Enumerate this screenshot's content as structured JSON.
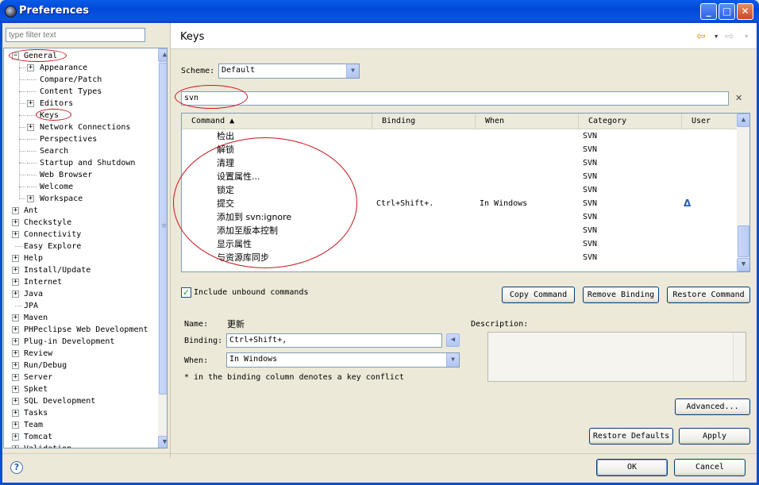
{
  "window": {
    "title": "Preferences",
    "minimize": "_",
    "maximize": "□",
    "close": "✕"
  },
  "filter": {
    "placeholder": "type filter text"
  },
  "tree": {
    "expand_plus": "+",
    "expand_minus": "−",
    "general": "General",
    "general_children": [
      {
        "label": "Appearance",
        "expandable": true
      },
      {
        "label": "Compare/Patch",
        "expandable": false
      },
      {
        "label": "Content Types",
        "expandable": false
      },
      {
        "label": "Editors",
        "expandable": true
      },
      {
        "label": "Keys",
        "expandable": false
      },
      {
        "label": "Network Connections",
        "expandable": true
      },
      {
        "label": "Perspectives",
        "expandable": false
      },
      {
        "label": "Search",
        "expandable": false
      },
      {
        "label": "Startup and Shutdown",
        "expandable": false
      },
      {
        "label": "Web Browser",
        "expandable": false
      },
      {
        "label": "Welcome",
        "expandable": false
      },
      {
        "label": "Workspace",
        "expandable": true
      }
    ],
    "top_items": [
      {
        "label": "Ant",
        "expandable": true
      },
      {
        "label": "Checkstyle",
        "expandable": true
      },
      {
        "label": "Connectivity",
        "expandable": true
      },
      {
        "label": "Easy Explore",
        "expandable": false
      },
      {
        "label": "Help",
        "expandable": true
      },
      {
        "label": "Install/Update",
        "expandable": true
      },
      {
        "label": "Internet",
        "expandable": true
      },
      {
        "label": "Java",
        "expandable": true
      },
      {
        "label": "JPA",
        "expandable": false
      },
      {
        "label": "Maven",
        "expandable": true
      },
      {
        "label": "PHPeclipse Web Development",
        "expandable": true
      },
      {
        "label": "Plug-in Development",
        "expandable": true
      },
      {
        "label": "Review",
        "expandable": true
      },
      {
        "label": "Run/Debug",
        "expandable": true
      },
      {
        "label": "Server",
        "expandable": true
      },
      {
        "label": "Spket",
        "expandable": true
      },
      {
        "label": "SQL Development",
        "expandable": true
      },
      {
        "label": "Tasks",
        "expandable": true
      },
      {
        "label": "Team",
        "expandable": true
      },
      {
        "label": "Tomcat",
        "expandable": true
      },
      {
        "label": "Validation",
        "expandable": true
      }
    ],
    "scroll_up": "▲",
    "scroll_down": "▼",
    "scroll_grip": "≡"
  },
  "header": {
    "title": "Keys",
    "back": "⇦",
    "forward": "⇨",
    "dropdown": "▼"
  },
  "scheme": {
    "label": "Scheme:",
    "value": "Default",
    "arrow": "▼"
  },
  "search": {
    "value": "svn",
    "clear_icon": "✕"
  },
  "table": {
    "columns": [
      "Command ▲",
      "Binding",
      "When",
      "Category",
      "User"
    ],
    "rows": [
      {
        "command": "检出",
        "binding": "",
        "when": "",
        "category": "SVN",
        "user": ""
      },
      {
        "command": "解锁",
        "binding": "",
        "when": "",
        "category": "SVN",
        "user": ""
      },
      {
        "command": "清理",
        "binding": "",
        "when": "",
        "category": "SVN",
        "user": ""
      },
      {
        "command": "设置属性...",
        "binding": "",
        "when": "",
        "category": "SVN",
        "user": ""
      },
      {
        "command": "锁定",
        "binding": "",
        "when": "",
        "category": "SVN",
        "user": ""
      },
      {
        "command": "提交",
        "binding": "Ctrl+Shift+.",
        "when": "In Windows",
        "category": "SVN",
        "user": "Δ"
      },
      {
        "command": "添加到 svn:ignore",
        "binding": "",
        "when": "",
        "category": "SVN",
        "user": ""
      },
      {
        "command": "添加至版本控制",
        "binding": "",
        "when": "",
        "category": "SVN",
        "user": ""
      },
      {
        "command": "显示属性",
        "binding": "",
        "when": "",
        "category": "SVN",
        "user": ""
      },
      {
        "command": "与资源库同步",
        "binding": "",
        "when": "",
        "category": "SVN",
        "user": ""
      }
    ],
    "scroll_up": "▲",
    "scroll_down": "▼"
  },
  "include_unbound": {
    "checked": "✓",
    "label": "Include unbound commands"
  },
  "buttons": {
    "copy_command": "Copy Command",
    "remove_binding": "Remove Binding",
    "restore_command": "Restore Command",
    "advanced": "Advanced...",
    "restore_defaults": "Restore Defaults",
    "apply": "Apply",
    "ok": "OK",
    "cancel": "Cancel"
  },
  "details": {
    "name_label": "Name:",
    "name_value": "更新",
    "binding_label": "Binding:",
    "binding_value": "Ctrl+Shift+,",
    "binding_btn": "◀",
    "when_label": "When:",
    "when_value": "In Windows",
    "when_arrow": "▼",
    "conflict_note": "* in the binding column denotes a key conflict",
    "description_label": "Description:"
  },
  "help": {
    "icon": "?"
  },
  "colors": {
    "title_blue": "#0A5BE8",
    "annotation_red": "#C8161D"
  }
}
